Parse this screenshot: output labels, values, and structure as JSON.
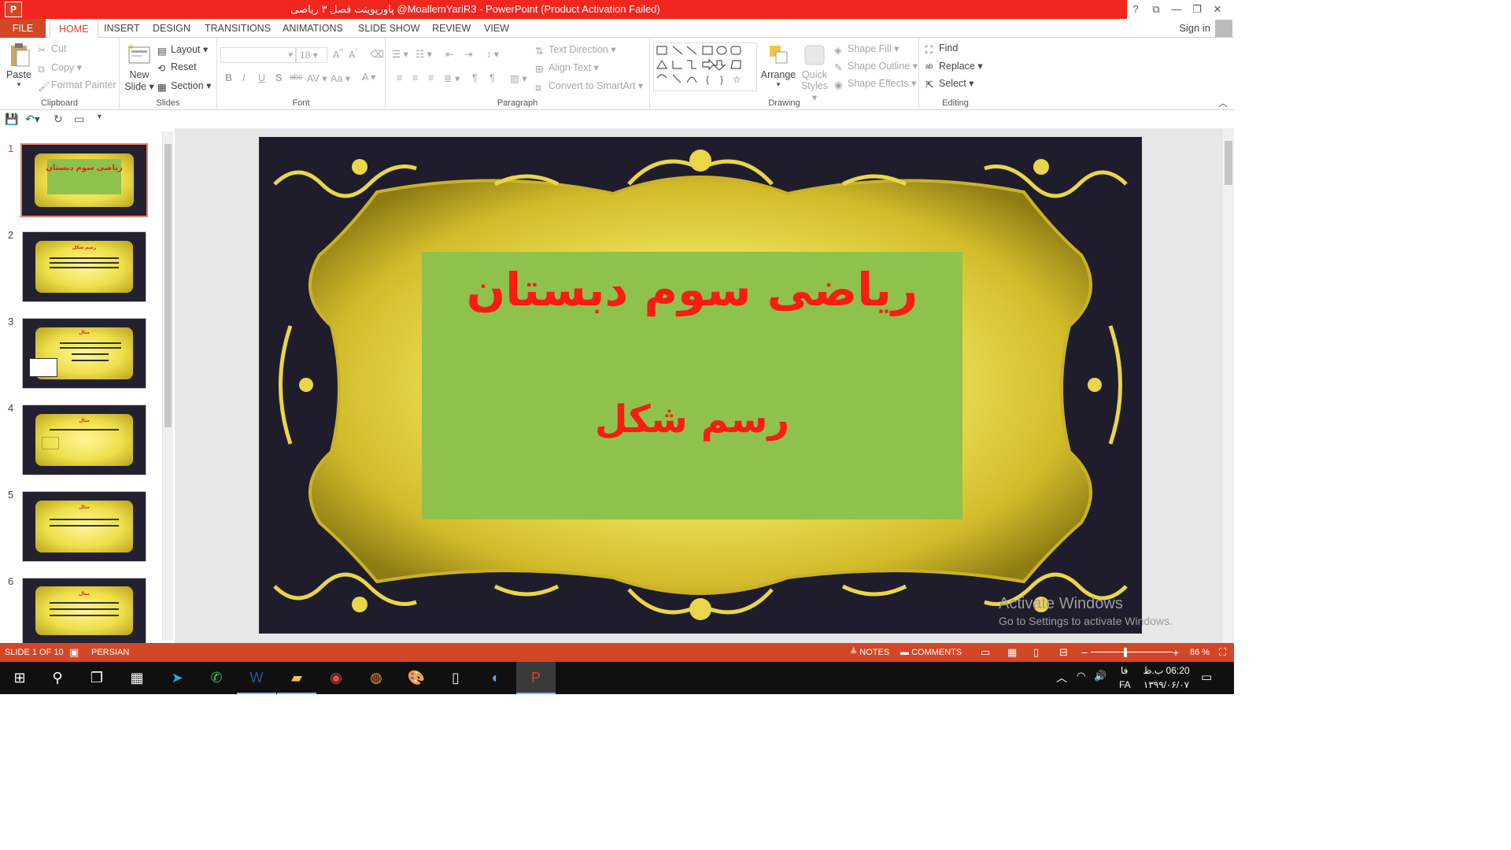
{
  "window": {
    "title": "پاورپوینت فصل ۳ ریاضی @MoallemYariR3  -  PowerPoint (Product Activation Failed)",
    "help": "?",
    "app_icon": "P"
  },
  "tabs": [
    "FILE",
    "HOME",
    "INSERT",
    "DESIGN",
    "TRANSITIONS",
    "ANIMATIONS",
    "SLIDE SHOW",
    "REVIEW",
    "VIEW"
  ],
  "account": {
    "sign_in": "Sign in"
  },
  "ribbon": {
    "clipboard": {
      "paste": "Paste",
      "cut": "Cut",
      "copy": "Copy",
      "format_painter": "Format Painter",
      "label": "Clipboard"
    },
    "slides": {
      "new_slide_1": "New",
      "new_slide_2": "Slide",
      "layout": "Layout",
      "reset": "Reset",
      "section": "Section",
      "label": "Slides"
    },
    "font": {
      "size": "18",
      "label": "Font"
    },
    "paragraph": {
      "text_direction": "Text Direction",
      "align_text": "Align Text",
      "convert_smartart": "Convert to SmartArt",
      "label": "Paragraph"
    },
    "drawing": {
      "arrange": "Arrange",
      "quick_styles_1": "Quick",
      "quick_styles_2": "Styles",
      "shape_fill": "Shape Fill",
      "shape_outline": "Shape Outline",
      "shape_effects": "Shape Effects",
      "label": "Drawing"
    },
    "editing": {
      "find": "Find",
      "replace": "Replace",
      "select": "Select",
      "label": "Editing"
    }
  },
  "thumbnails": [
    {
      "num": "1",
      "title": "ریاضی سوم دبستان"
    },
    {
      "num": "2",
      "title": "رسم شکل"
    },
    {
      "num": "3",
      "title": "مثال"
    },
    {
      "num": "4",
      "title": "مثال"
    },
    {
      "num": "5",
      "title": "مثال"
    },
    {
      "num": "6",
      "title": "مثال"
    }
  ],
  "slide": {
    "title": "ریاضی سوم دبستان",
    "subtitle": "رسم شکل"
  },
  "watermark": {
    "line1": "Activate Windows",
    "line2": "Go to Settings to activate Windows."
  },
  "status": {
    "slide_of": "SLIDE 1 OF 10",
    "language": "PERSIAN",
    "notes": "NOTES",
    "comments": "COMMENTS",
    "zoom": "86 %"
  },
  "taskbar": {
    "clock_time": "06:20 ب.ظ",
    "clock_date": "۱۳۹۹/۰۶/۰۷",
    "lang_fa": "فا",
    "lang_code": "FA"
  },
  "colors": {
    "accent": "#d24726",
    "titlebar": "#f0261f",
    "title_text": "#ff1a12",
    "title_box": "#8ec24d"
  }
}
